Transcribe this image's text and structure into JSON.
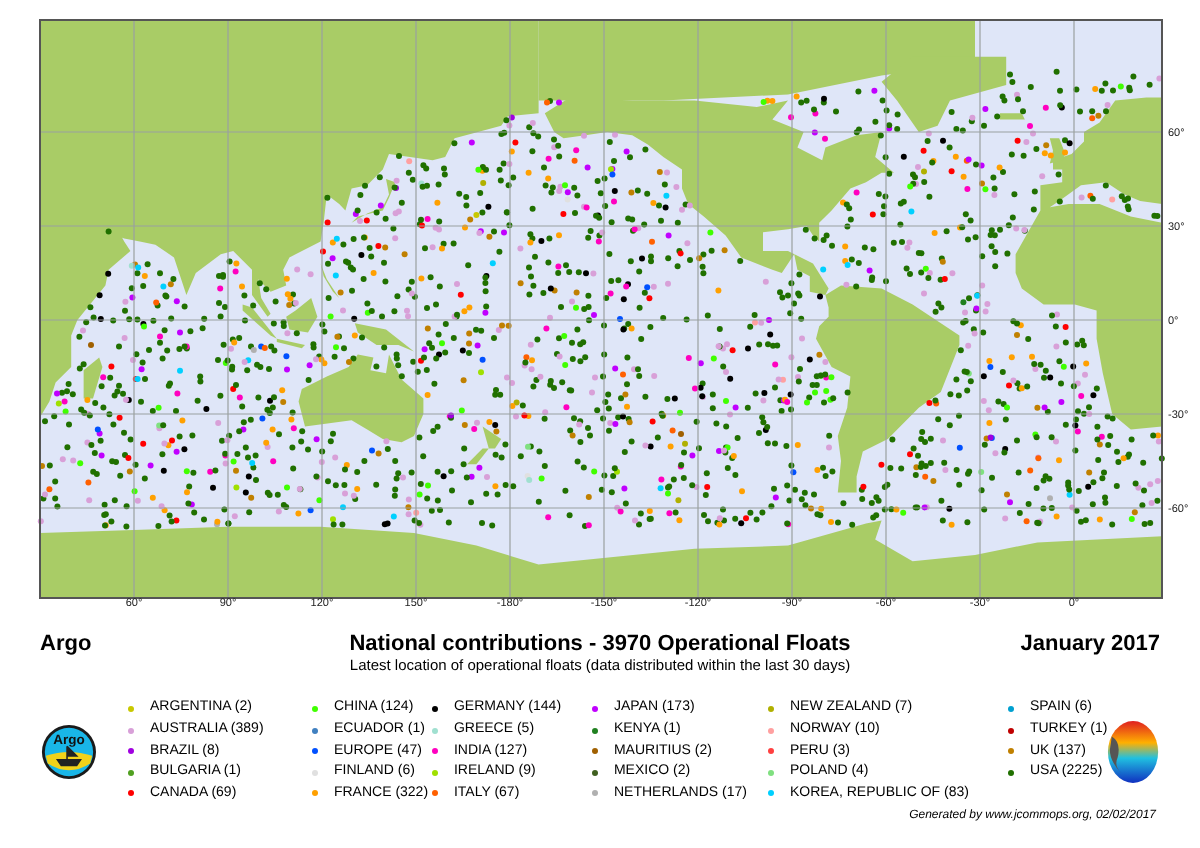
{
  "map": {
    "xtick_labels": [
      "60°",
      "90°",
      "120°",
      "150°",
      "-180°",
      "-150°",
      "-120°",
      "-90°",
      "-60°",
      "-30°",
      "0°"
    ],
    "ytick_labels": [
      "60°",
      "30°",
      "0°",
      "-30°",
      "-60°"
    ]
  },
  "header": {
    "program": "Argo",
    "title": "National contributions - 3970 Operational Floats",
    "date": "January 2017",
    "subtitle": "Latest location of operational floats (data distributed within the last 30 days)"
  },
  "legend": [
    {
      "label": "ARGENTINA (2)",
      "color": "#c8c800"
    },
    {
      "label": "AUSTRALIA (389)",
      "color": "#d8a0d8"
    },
    {
      "label": "BRAZIL (8)",
      "color": "#a000e0"
    },
    {
      "label": "BULGARIA (1)",
      "color": "#50a020"
    },
    {
      "label": "CANADA (69)",
      "color": "#ff0000"
    },
    {
      "label": "CHINA (124)",
      "color": "#40ff00"
    },
    {
      "label": "ECUADOR (1)",
      "color": "#4080c0"
    },
    {
      "label": "EUROPE (47)",
      "color": "#0050ff"
    },
    {
      "label": "FINLAND (6)",
      "color": "#e0e0e0"
    },
    {
      "label": "FRANCE (322)",
      "color": "#ffa000"
    },
    {
      "label": "GERMANY (144)",
      "color": "#000000"
    },
    {
      "label": "GREECE (5)",
      "color": "#a0e0d0"
    },
    {
      "label": "INDIA (127)",
      "color": "#ff00c0"
    },
    {
      "label": "IRELAND (9)",
      "color": "#a0e000"
    },
    {
      "label": "ITALY (67)",
      "color": "#ff6000"
    },
    {
      "label": "JAPAN (173)",
      "color": "#c000ff"
    },
    {
      "label": "KENYA (1)",
      "color": "#208020"
    },
    {
      "label": "MAURITIUS (2)",
      "color": "#a06000"
    },
    {
      "label": "MEXICO (2)",
      "color": "#406020"
    },
    {
      "label": "NETHERLANDS (17)",
      "color": "#b0b0b0"
    },
    {
      "label": "NEW ZEALAND (7)",
      "color": "#b0b000"
    },
    {
      "label": "NORWAY (10)",
      "color": "#ffa0a0"
    },
    {
      "label": "PERU (3)",
      "color": "#ff4040"
    },
    {
      "label": "POLAND (4)",
      "color": "#80e080"
    },
    {
      "label": "KOREA, REPUBLIC OF (83)",
      "color": "#00d0ff"
    },
    {
      "label": "SPAIN (6)",
      "color": "#00a0d0"
    },
    {
      "label": "TURKEY (1)",
      "color": "#c00000"
    },
    {
      "label": "UK (137)",
      "color": "#c08000"
    },
    {
      "label": "USA (2225)",
      "color": "#207000"
    }
  ],
  "logo": {
    "text": "Argo"
  },
  "footer": "Generated by www.jcommops.org, 02/02/2017"
}
